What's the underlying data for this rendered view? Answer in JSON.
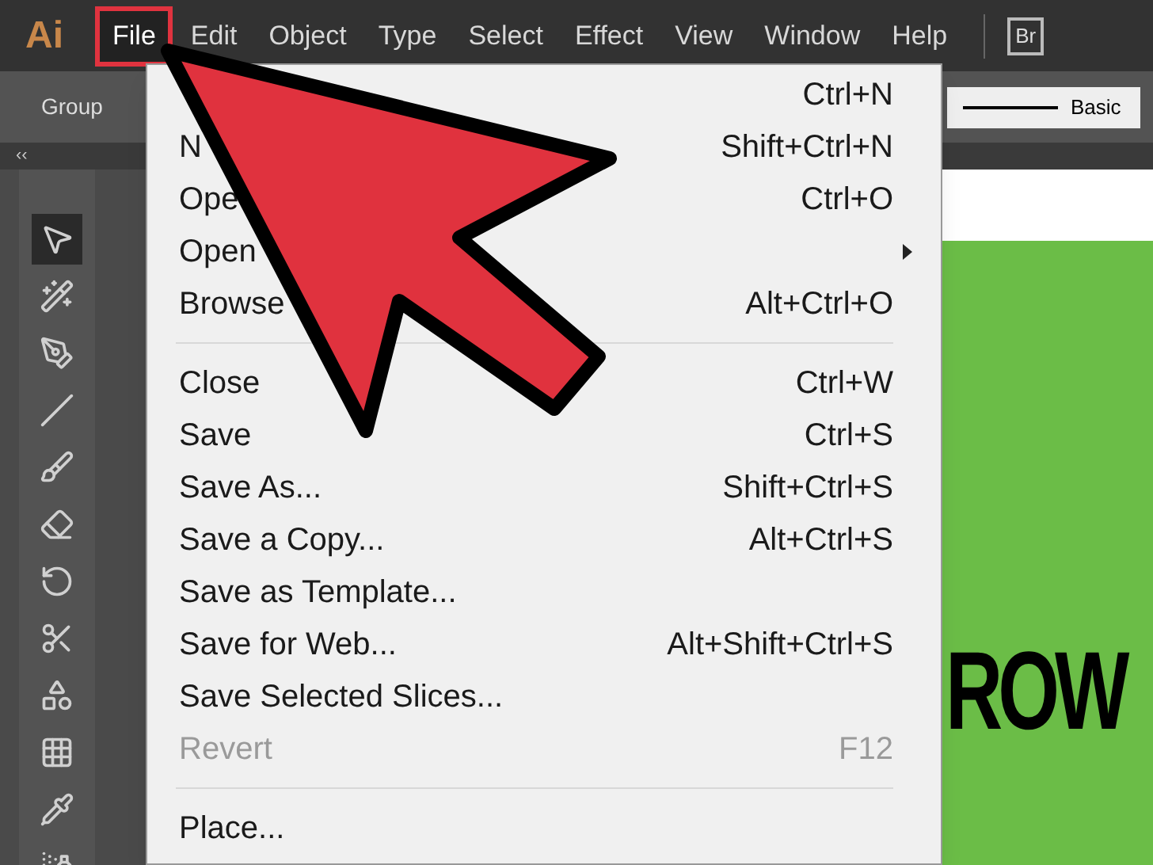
{
  "app_logo": "Ai",
  "menu_bar": [
    {
      "label": "File",
      "selected": true
    },
    {
      "label": "Edit",
      "selected": false
    },
    {
      "label": "Object",
      "selected": false
    },
    {
      "label": "Type",
      "selected": false
    },
    {
      "label": "Select",
      "selected": false
    },
    {
      "label": "Effect",
      "selected": false
    },
    {
      "label": "View",
      "selected": false
    },
    {
      "label": "Window",
      "selected": false
    },
    {
      "label": "Help",
      "selected": false
    }
  ],
  "bridge_button": "Br",
  "control_bar": {
    "left_label": "Group",
    "style_label": "Basic"
  },
  "panel_collapse": "‹‹",
  "file_menu": [
    {
      "kind": "item",
      "shortcut": "Ctrl+N",
      "disabled": false
    },
    {
      "kind": "item",
      "label": "N",
      "shortcut": "Shift+Ctrl+N",
      "disabled": false
    },
    {
      "kind": "item",
      "label": "Ope",
      "shortcut": "Ctrl+O",
      "disabled": false
    },
    {
      "kind": "submenu",
      "label": "Open",
      "disabled": false
    },
    {
      "kind": "item",
      "label": "Browse",
      "shortcut": "Alt+Ctrl+O",
      "disabled": false
    },
    {
      "kind": "separator"
    },
    {
      "kind": "item",
      "label": "Close",
      "shortcut": "Ctrl+W",
      "disabled": false
    },
    {
      "kind": "item",
      "label": "Save",
      "shortcut": "Ctrl+S",
      "disabled": false
    },
    {
      "kind": "item",
      "label": "Save As...",
      "shortcut": "Shift+Ctrl+S",
      "disabled": false
    },
    {
      "kind": "item",
      "label": "Save a Copy...",
      "shortcut": "Alt+Ctrl+S",
      "disabled": false
    },
    {
      "kind": "item",
      "label": "Save as Template...",
      "disabled": false
    },
    {
      "kind": "item",
      "label": "Save for Web...",
      "shortcut": "Alt+Shift+Ctrl+S",
      "disabled": false
    },
    {
      "kind": "item",
      "label": "Save Selected Slices...",
      "disabled": false
    },
    {
      "kind": "item",
      "label": "Revert",
      "shortcut": "F12",
      "disabled": true
    },
    {
      "kind": "separator"
    },
    {
      "kind": "item",
      "label": "Place...",
      "disabled": false
    }
  ],
  "canvas": {
    "artwork_text": "ROW"
  }
}
